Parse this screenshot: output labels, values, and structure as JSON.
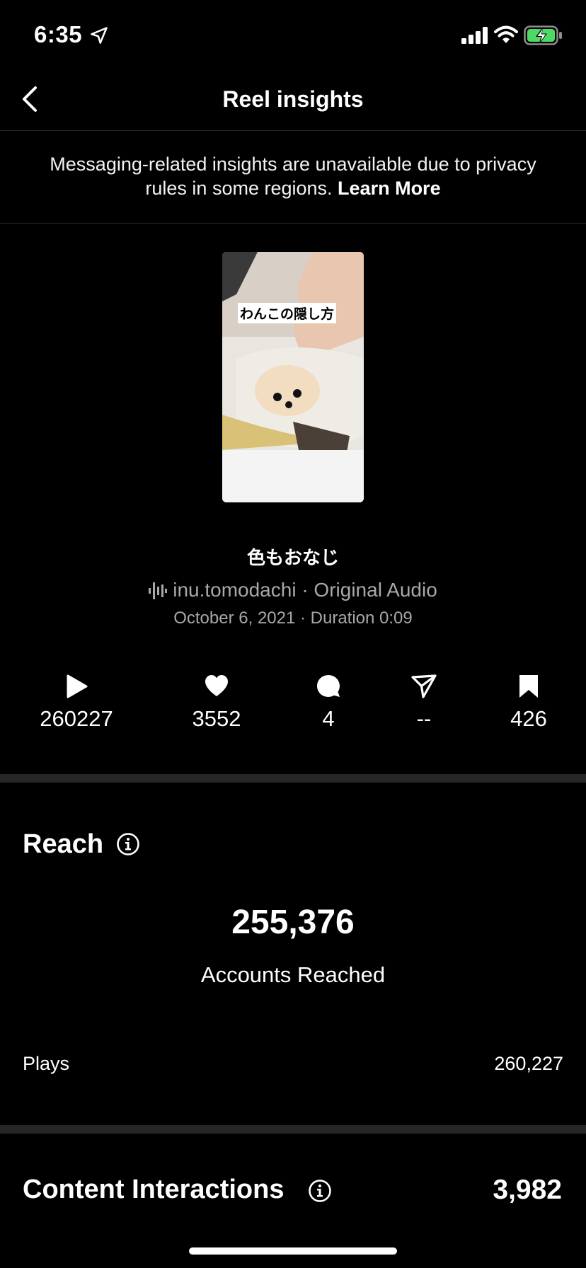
{
  "status": {
    "time": "6:35"
  },
  "nav": {
    "title": "Reel insights"
  },
  "notice": {
    "text": "Messaging-related insights are unavailable due to privacy rules in some regions.",
    "link": "Learn More"
  },
  "reel": {
    "thumbnail_caption": "わんこの隠し方",
    "title": "色もおなじ",
    "audio": "inu.tomodachi · Original Audio",
    "meta": "October 6, 2021 · Duration 0:09"
  },
  "stats": {
    "plays": "260227",
    "likes": "3552",
    "comments": "4",
    "shares": "--",
    "saves": "426"
  },
  "reach": {
    "title": "Reach",
    "value": "255,376",
    "label": "Accounts Reached",
    "plays_label": "Plays",
    "plays_value": "260,227"
  },
  "interactions": {
    "title": "Content Interactions",
    "value": "3,982"
  },
  "colors": {
    "background": "#000000",
    "text": "#ffffff",
    "muted": "#a8a8a8",
    "divider": "#262626",
    "battery": "#4cd964"
  }
}
